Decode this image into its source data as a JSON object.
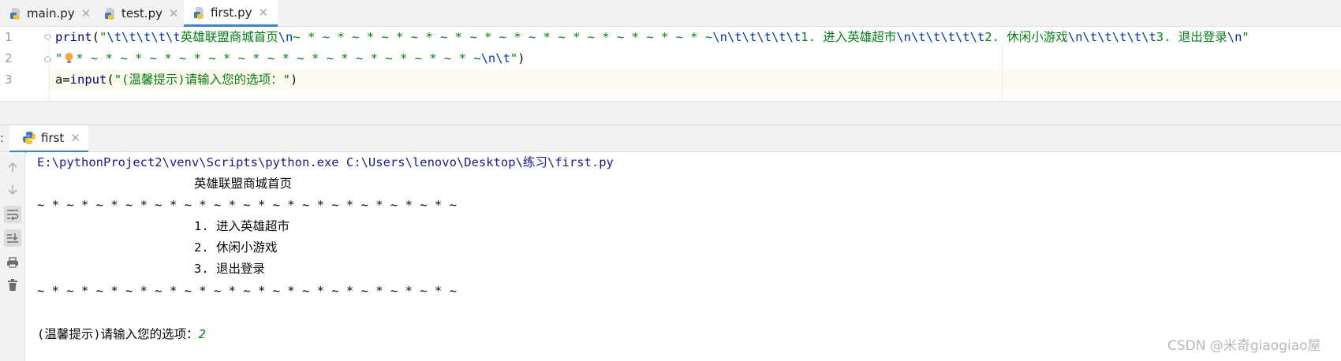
{
  "editor_tabs": [
    {
      "label": "main.py",
      "active": false
    },
    {
      "label": "test.py",
      "active": false
    },
    {
      "label": "first.py",
      "active": true
    }
  ],
  "code": {
    "line_numbers": [
      "1",
      "2",
      "3"
    ],
    "line1": {
      "fn": "print",
      "open": "(",
      "q": "\"",
      "esc1": "\\t\\t\\t\\t\\t",
      "s1": "英雄联盟商城首页",
      "esc2": "\\n",
      "s2": "~ * ~ * ~ * ~ * ~ * ~ * ~ * ~ * ~ * ~ * ~ * ~ * ~ * ~ * ~",
      "esc3": "\\n\\t\\t\\t\\t\\t",
      "s3": "1. 进入英雄超市",
      "esc4": "\\n\\t\\t\\t\\t\\t",
      "s4": "2. 休闲小游戏",
      "esc5": "\\n\\t\\t\\t\\t\\t",
      "s5": "3. 退出登录",
      "esc6": "\\n",
      "q2": "\""
    },
    "line2": {
      "q": "\"",
      "s1": "* ~ * ~ * ~ * ~ * ~ * ~ * ~ * ~ * ~ * ~ * ~ * ~ * ~ * ~",
      "esc1": "\\n\\t",
      "q2": "\"",
      "close": ")"
    },
    "line3": {
      "var": "a=",
      "fn": "input",
      "open": "(",
      "str": "\"(温馨提示)请输入您的选项：\"",
      "close": ")"
    }
  },
  "run_panel": {
    "colon": ":",
    "tab_label": "first",
    "output": {
      "command": "E:\\pythonProject2\\venv\\Scripts\\python.exe C:\\Users\\lenovo\\Desktop\\练习\\first.py",
      "title": "英雄联盟商城首页",
      "divider": "~ * ~ * ~ * ~ * ~ * ~ * ~ * ~ * ~ * ~ * ~ * ~ * ~ * ~ * ~",
      "option1": "1. 进入英雄超市",
      "option2": "2. 休闲小游戏",
      "option3": "3. 退出登录",
      "divider2": "~ * ~ * ~ * ~ * ~ * ~ * ~ * ~ * ~ * ~ * ~ * ~ * ~ * ~ * ~",
      "prompt": "(温馨提示)请输入您的选项：",
      "user_input": "2"
    }
  },
  "watermark": "CSDN @米奇giaogiao屋",
  "colors": {
    "accent": "#4083c9",
    "string": "#067d17",
    "keyword": "#000080",
    "escape": "#0037a6"
  },
  "icons": {
    "tab_file": "python-file-icon",
    "run_tab": "python-icon",
    "tools": [
      "arrow-up-icon",
      "arrow-down-icon",
      "soft-wrap-icon",
      "scroll-to-end-icon",
      "print-icon",
      "trash-icon"
    ],
    "hint": "lightbulb-icon"
  }
}
